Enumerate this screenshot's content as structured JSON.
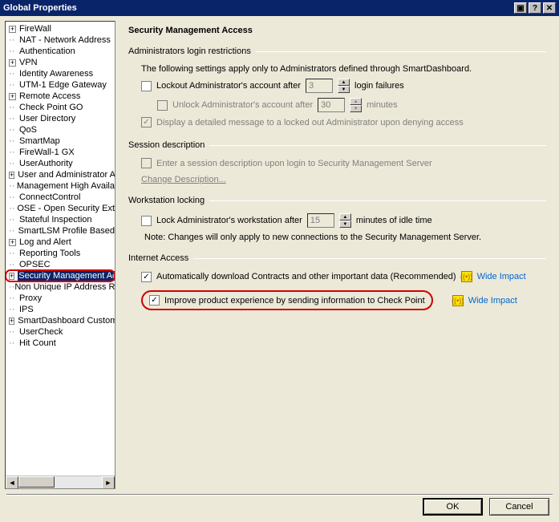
{
  "title": "Global Properties",
  "tree": [
    {
      "exp": "+",
      "label": "FireWall"
    },
    {
      "exp": "",
      "label": "NAT - Network Address"
    },
    {
      "exp": "",
      "label": "Authentication"
    },
    {
      "exp": "+",
      "label": "VPN"
    },
    {
      "exp": "",
      "label": "Identity Awareness"
    },
    {
      "exp": "",
      "label": "UTM-1 Edge Gateway"
    },
    {
      "exp": "+",
      "label": "Remote Access"
    },
    {
      "exp": "",
      "label": "Check Point GO"
    },
    {
      "exp": "",
      "label": "User Directory"
    },
    {
      "exp": "",
      "label": "QoS"
    },
    {
      "exp": "",
      "label": "SmartMap"
    },
    {
      "exp": "",
      "label": "FireWall-1 GX"
    },
    {
      "exp": "",
      "label": "UserAuthority"
    },
    {
      "exp": "+",
      "label": "User and Administrator A"
    },
    {
      "exp": "",
      "label": "Management High Availa"
    },
    {
      "exp": "",
      "label": "ConnectControl"
    },
    {
      "exp": "",
      "label": "OSE - Open Security Ext"
    },
    {
      "exp": "",
      "label": "Stateful Inspection"
    },
    {
      "exp": "",
      "label": "SmartLSM Profile Based"
    },
    {
      "exp": "+",
      "label": "Log and Alert"
    },
    {
      "exp": "",
      "label": "Reporting Tools"
    },
    {
      "exp": "",
      "label": "OPSEC"
    },
    {
      "exp": "+",
      "label": "Security Management Ac",
      "selected": true,
      "highlight": true
    },
    {
      "exp": "",
      "label": "Non Unique IP Address R"
    },
    {
      "exp": "",
      "label": "Proxy"
    },
    {
      "exp": "",
      "label": "IPS"
    },
    {
      "exp": "+",
      "label": "SmartDashboard Custom"
    },
    {
      "exp": "",
      "label": "UserCheck"
    },
    {
      "exp": "",
      "label": "Hit Count"
    }
  ],
  "main": {
    "heading": "Security Management Access",
    "group1": {
      "title": "Administrators login restrictions",
      "intro": "The following settings apply only to Administrators defined through SmartDashboard.",
      "lockout_label": "Lockout Administrator's account after",
      "lockout_value": "3",
      "lockout_suffix": "login failures",
      "unlock_label": "Unlock Administrator's account after",
      "unlock_value": "30",
      "unlock_suffix": "minutes",
      "display_msg": "Display a detailed message to a locked out Administrator upon denying access"
    },
    "group2": {
      "title": "Session description",
      "enter_desc": "Enter a session description upon login to Security Management Server",
      "change_desc": "Change Description..."
    },
    "group3": {
      "title": "Workstation locking",
      "lock_label": "Lock Administrator's workstation after",
      "lock_value": "15",
      "lock_suffix": "minutes of idle time",
      "note": "Note: Changes will only apply to new connections to the Security Management Server."
    },
    "group4": {
      "title": "Internet Access",
      "auto_download": "Automatically download Contracts and other important data (Recommended)",
      "improve": "Improve product experience by sending information to Check Point",
      "wide_impact": "Wide Impact"
    }
  },
  "buttons": {
    "ok": "OK",
    "cancel": "Cancel"
  }
}
